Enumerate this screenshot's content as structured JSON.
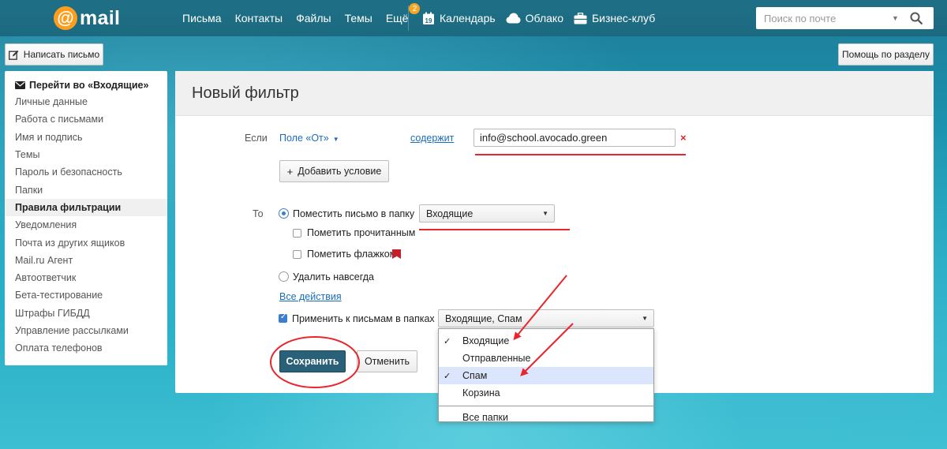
{
  "topbar": {
    "logo_symbol": "@",
    "logo_text": "mail",
    "nav": [
      {
        "label": "Письма"
      },
      {
        "label": "Контакты"
      },
      {
        "label": "Файлы"
      },
      {
        "label": "Темы"
      },
      {
        "label": "Ещё",
        "badge": "2"
      }
    ],
    "nav2": [
      {
        "label": "Календарь",
        "icon": "calendar-icon",
        "icon_text": "19"
      },
      {
        "label": "Облако",
        "icon": "cloud-icon"
      },
      {
        "label": "Бизнес-клуб",
        "icon": "briefcase-icon"
      }
    ],
    "search_placeholder": "Поиск по почте"
  },
  "toolbar": {
    "compose_label": "Написать письмо",
    "help_label": "Помощь по разделу"
  },
  "sidebar": {
    "inbox_link": "Перейти во «Входящие»",
    "items": [
      {
        "label": "Личные данные",
        "active": false
      },
      {
        "label": "Работа с письмами",
        "active": false
      },
      {
        "label": "Имя и подпись",
        "active": false
      },
      {
        "label": "Темы",
        "active": false
      },
      {
        "label": "Пароль и безопасность",
        "active": false
      },
      {
        "label": "Папки",
        "active": false
      },
      {
        "label": "Правила фильтрации",
        "active": true
      },
      {
        "label": "Уведомления",
        "active": false
      },
      {
        "label": "Почта из других ящиков",
        "active": false
      },
      {
        "label": "Mail.ru Агент",
        "active": false
      },
      {
        "label": "Автоответчик",
        "active": false
      },
      {
        "label": "Бета-тестирование",
        "active": false
      },
      {
        "label": "Штрафы ГИБДД",
        "active": false
      },
      {
        "label": "Управление рассылками",
        "active": false
      },
      {
        "label": "Оплата телефонов",
        "active": false
      }
    ]
  },
  "filter": {
    "title": "Новый фильтр",
    "if_label": "Если",
    "field_dropdown": "Поле «От»",
    "operator_link": "содержит",
    "condition_value": "info@school.avocado.green",
    "clear_symbol": "×",
    "add_condition_label": "Добавить условие",
    "add_condition_icon_text": "+",
    "then_label": "То",
    "move_to_folder_label": "Поместить письмо в папку",
    "move_to_folder_checked": true,
    "folder_select": "Входящие",
    "mark_read_label": "Пометить прочитанным",
    "mark_read_checked": false,
    "mark_flag_label": "Пометить флажком",
    "mark_flag_checked": false,
    "delete_forever_label": "Удалить навсегда",
    "delete_forever_checked": false,
    "all_actions_link": "Все действия",
    "apply_to_folders_label": "Применить к письмам в папках",
    "apply_to_folders_checked": true,
    "folders_select": "Входящие, Спам",
    "save_label": "Сохранить",
    "cancel_label": "Отменить"
  },
  "folders_dropdown": {
    "check_mark": "✓",
    "items": [
      {
        "label": "Входящие",
        "checked": true,
        "highlighted": false
      },
      {
        "label": "Отправленные",
        "checked": false,
        "highlighted": false
      },
      {
        "label": "Спам",
        "checked": true,
        "highlighted": true
      },
      {
        "label": "Корзина",
        "checked": false,
        "highlighted": false
      }
    ],
    "all_folders_label": "Все папки"
  },
  "colors": {
    "topbar": "#1e6f86",
    "accent_orange": "#ff9d1c",
    "link_blue": "#1a6dbd",
    "save_button": "#2a6178",
    "annotation_red": "#e8262c"
  }
}
